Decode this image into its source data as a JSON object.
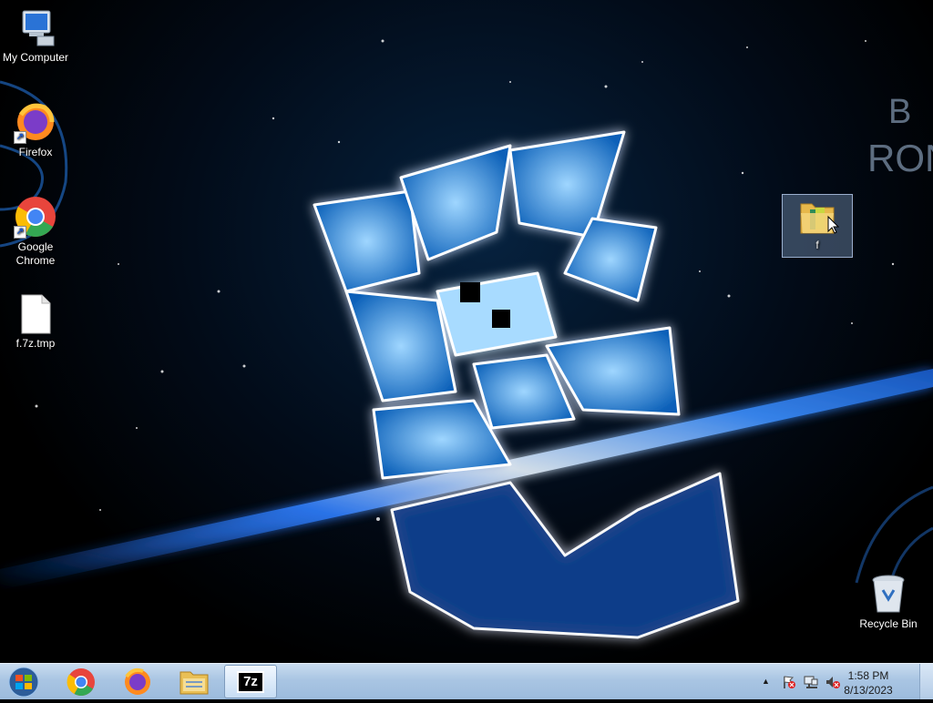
{
  "desktop": {
    "icons": [
      {
        "label": "My Computer",
        "icon": "computer-icon"
      },
      {
        "label": "Firefox",
        "icon": "firefox-icon"
      },
      {
        "label": "Google\nChrome",
        "icon": "chrome-icon"
      },
      {
        "label": "f.7z.tmp",
        "icon": "file-icon"
      },
      {
        "label": "f",
        "icon": "folder-icon"
      },
      {
        "label": "Recycle Bin",
        "icon": "recycle-bin-icon"
      }
    ]
  },
  "taskbar": {
    "pinned": [
      {
        "name": "chrome",
        "icon": "chrome-icon"
      },
      {
        "name": "firefox",
        "icon": "firefox-icon"
      },
      {
        "name": "file-explorer",
        "icon": "folder-icon"
      },
      {
        "name": "7zip",
        "icon": "7zip-icon",
        "label": "7z",
        "active": true
      }
    ],
    "tray": {
      "icons": [
        "show-hidden-icons-chevron",
        "action-center-flag-icon",
        "network-icon",
        "volume-muted-icon"
      ]
    },
    "clock": {
      "time": "1:58 PM",
      "date": "8/13/2023"
    }
  },
  "wallpaper": {
    "corner_text_1": "B",
    "corner_text_2": "RON"
  },
  "colors": {
    "accent_glow": "#3aa0ff",
    "taskbar": "#a9c5e3"
  }
}
